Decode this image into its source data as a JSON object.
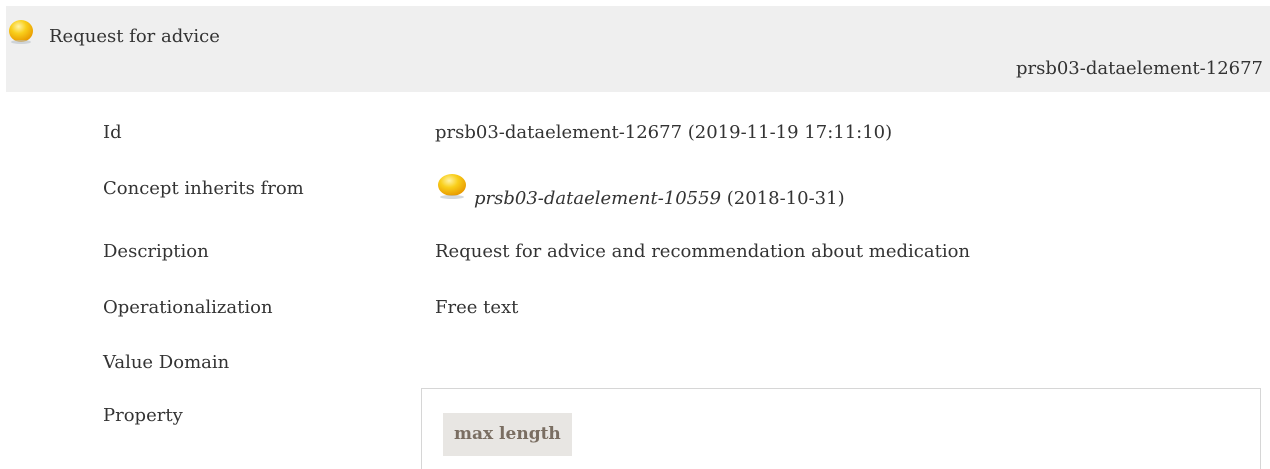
{
  "header": {
    "title": "Request for advice",
    "id": "prsb03-dataelement-12677",
    "status_icon": "status-circle-icon",
    "status_color": "#f6c40a"
  },
  "rows": {
    "id": {
      "label": "Id",
      "value": "prsb03-dataelement-12677 (2019-11-19 17:11:10)"
    },
    "inherits": {
      "label": "Concept inherits from",
      "link_text": "prsb03-dataelement-10559",
      "suffix": " (2018-10-31)",
      "status_icon": "status-circle-icon"
    },
    "description": {
      "label": "Description",
      "value": "Request for advice and recommendation about medication"
    },
    "operationalization": {
      "label": "Operationalization",
      "value": "Free text"
    },
    "value_domain": {
      "label": "Value Domain"
    },
    "property": {
      "label": "Property",
      "chip": "max length"
    }
  }
}
